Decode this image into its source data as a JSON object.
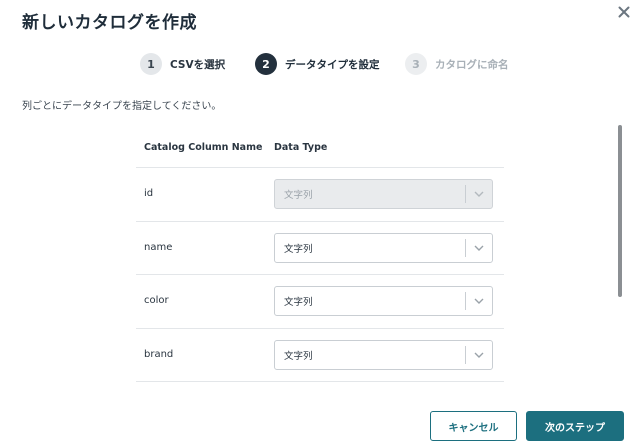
{
  "dialog": {
    "title": "新しいカタログを作成",
    "close_icon": "close-icon"
  },
  "steps": [
    {
      "number": "1",
      "label": "CSVを選択",
      "state": "done"
    },
    {
      "number": "2",
      "label": "データタイプを設定",
      "state": "active"
    },
    {
      "number": "3",
      "label": "カタログに命名",
      "state": "pending"
    }
  ],
  "description": "列ごとにデータタイプを指定してください。",
  "table": {
    "headers": {
      "column_name": "Catalog Column Name",
      "data_type": "Data Type"
    },
    "rows": [
      {
        "name": "id",
        "type": "文字列",
        "disabled": true
      },
      {
        "name": "name",
        "type": "文字列",
        "disabled": false
      },
      {
        "name": "color",
        "type": "文字列",
        "disabled": false
      },
      {
        "name": "brand",
        "type": "文字列",
        "disabled": false
      }
    ]
  },
  "footer": {
    "cancel_label": "キャンセル",
    "next_label": "次のステップ"
  },
  "colors": {
    "accent": "#1c6f7f",
    "active_step": "#23303d",
    "text": "#1f2d3a"
  }
}
